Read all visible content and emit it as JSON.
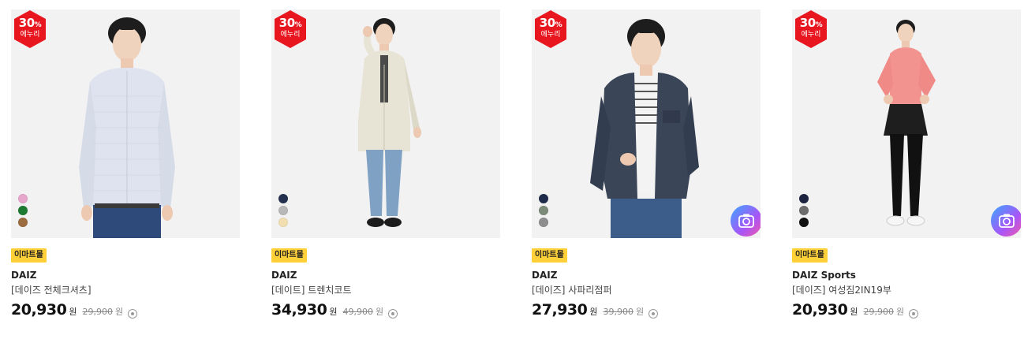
{
  "products": [
    {
      "discount_pct": "30",
      "discount_unit": "%",
      "discount_sub": "에누리",
      "mall_tag": "이마트몰",
      "brand": "DAIZ",
      "name": "[데이즈 전체크셔츠]",
      "price": "20,930",
      "price_unit": "원",
      "original_price": "29,900",
      "original_unit": "원",
      "swatches": [
        "#e7a6cc",
        "#1f7a31",
        "#9c6b3f"
      ],
      "has_camera": false,
      "outfit": "shirt"
    },
    {
      "discount_pct": "30",
      "discount_unit": "%",
      "discount_sub": "에누리",
      "mall_tag": "이마트몰",
      "brand": "DAIZ",
      "name": "[데이트] 트렌치코트",
      "price": "34,930",
      "price_unit": "원",
      "original_price": "49,900",
      "original_unit": "원",
      "swatches": [
        "#23304f",
        "#b8b8b8",
        "#f1dfb2"
      ],
      "has_camera": false,
      "outfit": "trench"
    },
    {
      "discount_pct": "30",
      "discount_unit": "%",
      "discount_sub": "에누리",
      "mall_tag": "이마트몰",
      "brand": "DAIZ",
      "name": "[데이즈] 사파리점퍼",
      "price": "27,930",
      "price_unit": "원",
      "original_price": "39,900",
      "original_unit": "원",
      "swatches": [
        "#1f2b4a",
        "#7c8a78",
        "#8e8e8e"
      ],
      "has_camera": true,
      "outfit": "jacket"
    },
    {
      "discount_pct": "30",
      "discount_unit": "%",
      "discount_sub": "에누리",
      "mall_tag": "이마트몰",
      "brand": "DAIZ Sports",
      "name": "[데이즈] 여성짐2IN19부",
      "price": "20,930",
      "price_unit": "원",
      "original_price": "29,900",
      "original_unit": "원",
      "swatches": [
        "#1c2340",
        "#6d6d6d",
        "#111111"
      ],
      "has_camera": true,
      "outfit": "sports"
    }
  ],
  "colors": {
    "badge_red": "#e8161f",
    "mall_tag_bg": "#ffd037"
  }
}
